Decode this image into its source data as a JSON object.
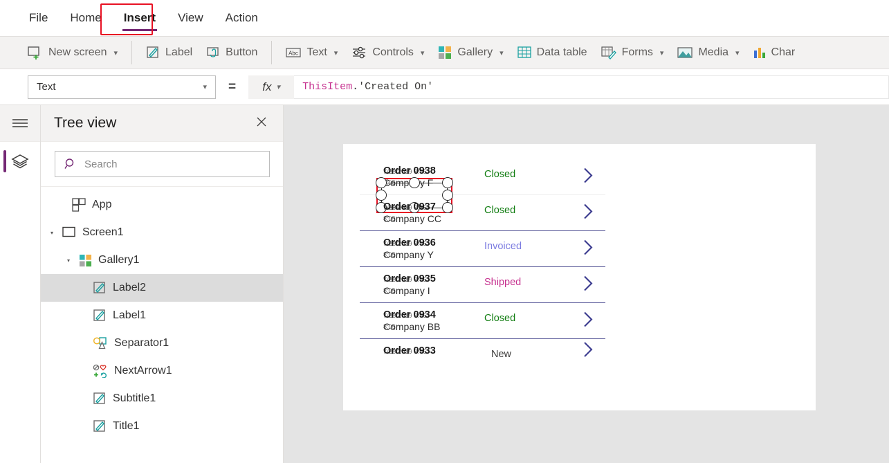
{
  "menu": {
    "items": [
      {
        "label": "File",
        "active": false
      },
      {
        "label": "Home",
        "active": false
      },
      {
        "label": "Insert",
        "active": true
      },
      {
        "label": "View",
        "active": false
      },
      {
        "label": "Action",
        "active": false
      }
    ]
  },
  "ribbon": {
    "groups": [
      {
        "buttons": [
          {
            "label": "New screen",
            "icon": "new-screen-icon",
            "caret": true
          }
        ]
      },
      {
        "buttons": [
          {
            "label": "Label",
            "icon": "label-icon",
            "caret": false
          },
          {
            "label": "Button",
            "icon": "button-icon",
            "caret": false
          }
        ]
      },
      {
        "buttons": [
          {
            "label": "Text",
            "icon": "text-abc-icon",
            "caret": true
          },
          {
            "label": "Controls",
            "icon": "controls-sliders-icon",
            "caret": true
          },
          {
            "label": "Gallery",
            "icon": "gallery-grid-icon",
            "caret": true
          },
          {
            "label": "Data table",
            "icon": "data-table-icon",
            "caret": false
          },
          {
            "label": "Forms",
            "icon": "forms-icon",
            "caret": true
          },
          {
            "label": "Media",
            "icon": "media-image-icon",
            "caret": true
          },
          {
            "label": "Char",
            "icon": "charts-icon",
            "caret": false
          }
        ]
      }
    ]
  },
  "formula_bar": {
    "property_value": "Text",
    "equals": "=",
    "fx_label": "fx",
    "formula": {
      "object": "ThisItem",
      "dot": ".",
      "property": "'Created On'"
    }
  },
  "tree_view": {
    "title": "Tree view",
    "search_placeholder": "Search",
    "search_value": "",
    "items": [
      {
        "label": "App",
        "icon": "app-icon",
        "indent": 0,
        "caret": "",
        "selected": false
      },
      {
        "label": "Screen1",
        "icon": "screen-icon",
        "indent": 0,
        "caret": "expanded",
        "selected": false
      },
      {
        "label": "Gallery1",
        "icon": "gallery-grid-icon",
        "indent": 1,
        "caret": "expanded",
        "selected": false
      },
      {
        "label": "Label2",
        "icon": "label-icon",
        "indent": 2,
        "caret": "",
        "selected": true
      },
      {
        "label": "Label1",
        "icon": "label-icon",
        "indent": 2,
        "caret": "",
        "selected": false
      },
      {
        "label": "Separator1",
        "icon": "shapes-icon",
        "indent": 2,
        "caret": "",
        "selected": false
      },
      {
        "label": "NextArrow1",
        "icon": "icons-grid-icon",
        "indent": 2,
        "caret": "",
        "selected": false
      },
      {
        "label": "Subtitle1",
        "icon": "label-icon",
        "indent": 2,
        "caret": "",
        "selected": false
      },
      {
        "label": "Title1",
        "icon": "label-icon",
        "indent": 2,
        "caret": "",
        "selected": false
      }
    ]
  },
  "canvas": {
    "gallery_rows": [
      {
        "title": "Order 0938",
        "date": "7/28/2019 8:05",
        "subtitle": "Company F",
        "time": "8:05",
        "status": "Closed",
        "status_color": "#107c10",
        "selected": true
      },
      {
        "title": "Order 0937",
        "date": "7/28/2019 8:05",
        "subtitle": "Company CC",
        "time": "8:05",
        "status": "Closed",
        "status_color": "#107c10",
        "selected": false
      },
      {
        "title": "Order 0936",
        "date": "7/28/2019 8:05",
        "subtitle": "Company Y",
        "time": "8:05",
        "status": "Invoiced",
        "status_color": "#7a7ae0",
        "selected": false
      },
      {
        "title": "Order 0935",
        "date": "7/28/2019 8:05",
        "subtitle": "Company I",
        "time": "8:05",
        "status": "Shipped",
        "status_color": "#c6318f",
        "selected": false
      },
      {
        "title": "Order 0934",
        "date": "7/28/2019 8:05",
        "subtitle": "Company BB",
        "time": "8:05",
        "status": "Closed",
        "status_color": "#107c10",
        "selected": false
      },
      {
        "title": "Order 0933",
        "date": "7/28/2019 8:05",
        "subtitle": "",
        "time": "",
        "status": "New",
        "status_color": "#3b3a39",
        "selected": false
      }
    ]
  },
  "colors": {
    "accent_purple": "#742774",
    "highlight_red": "#e81123",
    "formula_token": "#c6318f",
    "arrow_blue": "#3b3b8f"
  }
}
